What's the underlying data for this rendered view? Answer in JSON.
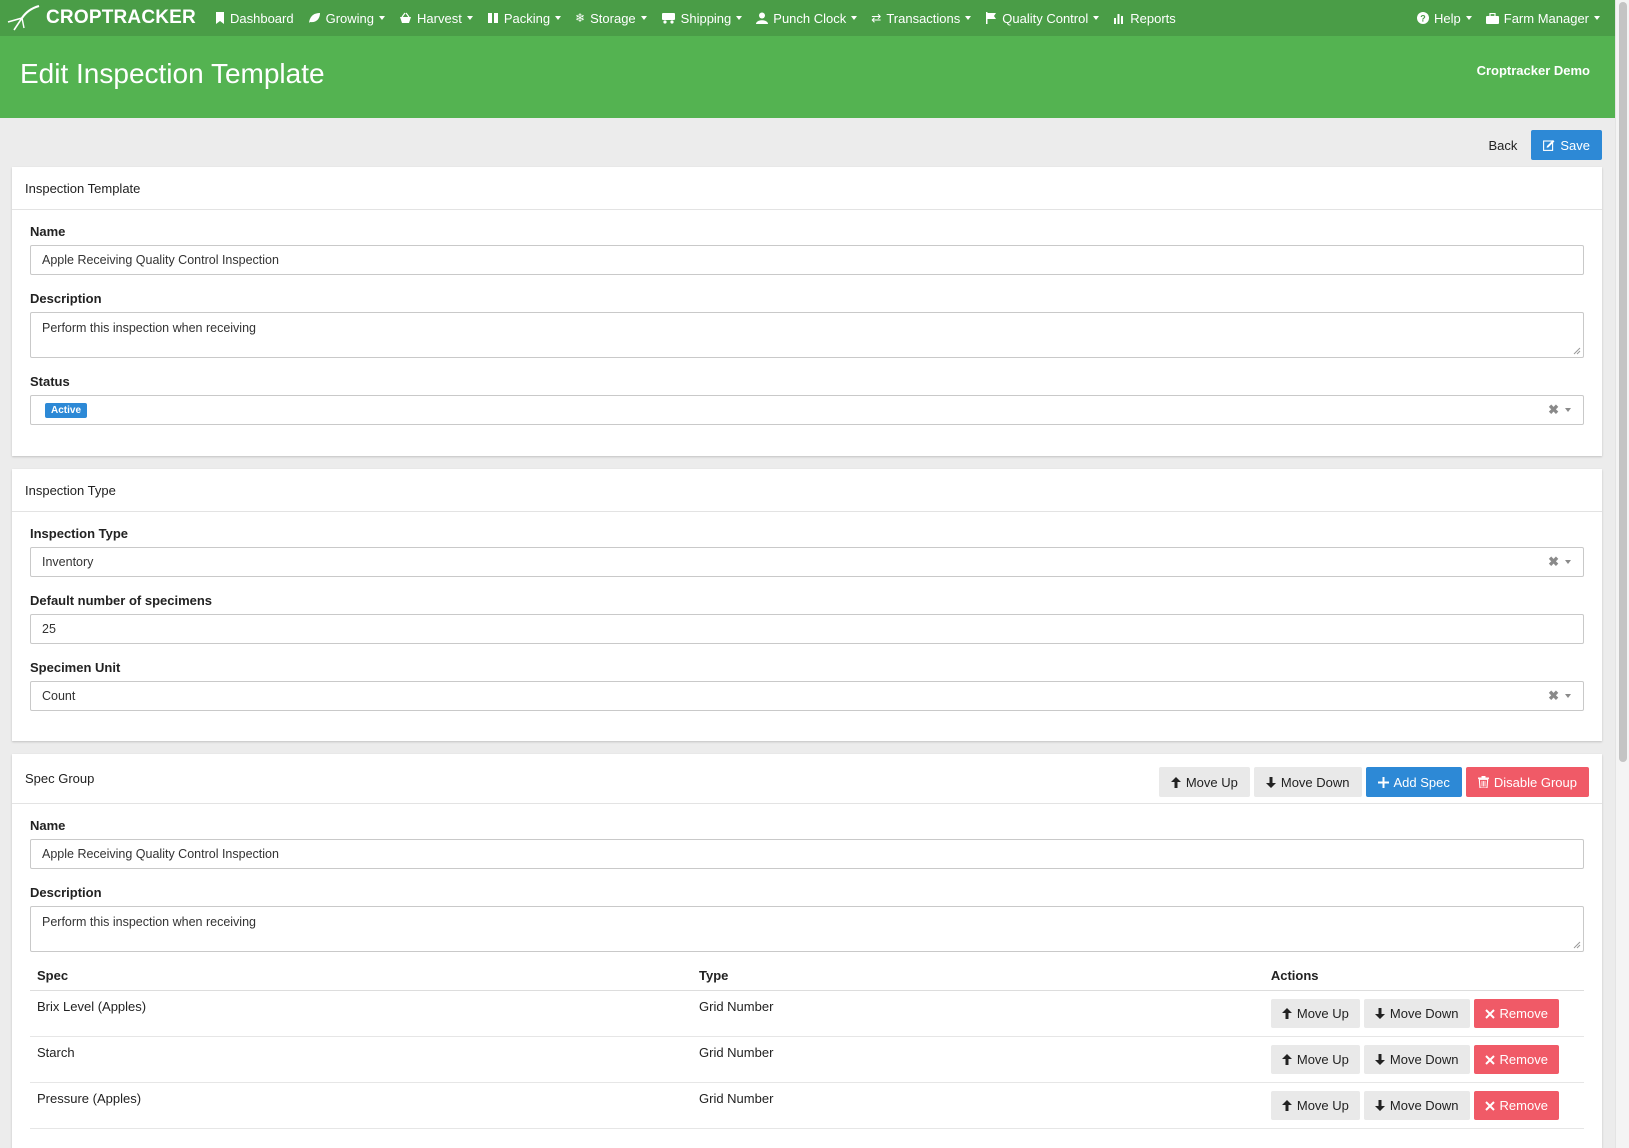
{
  "app": {
    "brand": "CROPTRACKER",
    "nav": [
      {
        "label": "Dashboard",
        "icon": "bookmark-icon",
        "has_caret": false
      },
      {
        "label": "Growing",
        "icon": "leaf-icon",
        "has_caret": true
      },
      {
        "label": "Harvest",
        "icon": "basket-icon",
        "has_caret": true
      },
      {
        "label": "Packing",
        "icon": "boxes-icon",
        "has_caret": true
      },
      {
        "label": "Storage",
        "icon": "snowflake-icon",
        "has_caret": true
      },
      {
        "label": "Shipping",
        "icon": "truck-icon",
        "has_caret": true
      },
      {
        "label": "Punch Clock",
        "icon": "user-icon",
        "has_caret": true
      },
      {
        "label": "Transactions",
        "icon": "transfer-icon",
        "has_caret": true
      },
      {
        "label": "Quality Control",
        "icon": "flag-icon",
        "has_caret": true
      },
      {
        "label": "Reports",
        "icon": "bar-chart-icon",
        "has_caret": false
      }
    ],
    "help_label": "Help",
    "user_label": "Farm Manager"
  },
  "header": {
    "title": "Edit Inspection Template",
    "company": "Croptracker Demo"
  },
  "actions": {
    "back_label": "Back",
    "save_label": "Save"
  },
  "template_panel": {
    "heading": "Inspection Template",
    "name_label": "Name",
    "name_value": "Apple Receiving Quality Control Inspection",
    "description_label": "Description",
    "description_value": "Perform this inspection when receiving",
    "status_label": "Status",
    "status_value": "Active"
  },
  "type_panel": {
    "heading": "Inspection Type",
    "type_label": "Inspection Type",
    "type_value": "Inventory",
    "specimens_label": "Default number of specimens",
    "specimens_value": "25",
    "unit_label": "Specimen Unit",
    "unit_value": "Count"
  },
  "spec_group": {
    "heading": "Spec Group",
    "move_up_label": "Move Up",
    "move_down_label": "Move Down",
    "add_spec_label": "Add Spec",
    "disable_label": "Disable Group",
    "name_label": "Name",
    "name_value": "Apple Receiving Quality Control Inspection",
    "description_label": "Description",
    "description_value": "Perform this inspection when receiving",
    "columns": {
      "spec": "Spec",
      "type": "Type",
      "actions": "Actions"
    },
    "rows": [
      {
        "spec": "Brix Level (Apples)",
        "type": "Grid Number"
      },
      {
        "spec": "Starch",
        "type": "Grid Number"
      },
      {
        "spec": "Pressure (Apples)",
        "type": "Grid Number"
      }
    ],
    "row_move_up": "Move Up",
    "row_move_down": "Move Down",
    "row_remove": "Remove"
  },
  "colors": {
    "nav_bg": "#4a9d47",
    "header_bg": "#54b351",
    "primary": "#2d89d6",
    "danger": "#f05a67"
  }
}
